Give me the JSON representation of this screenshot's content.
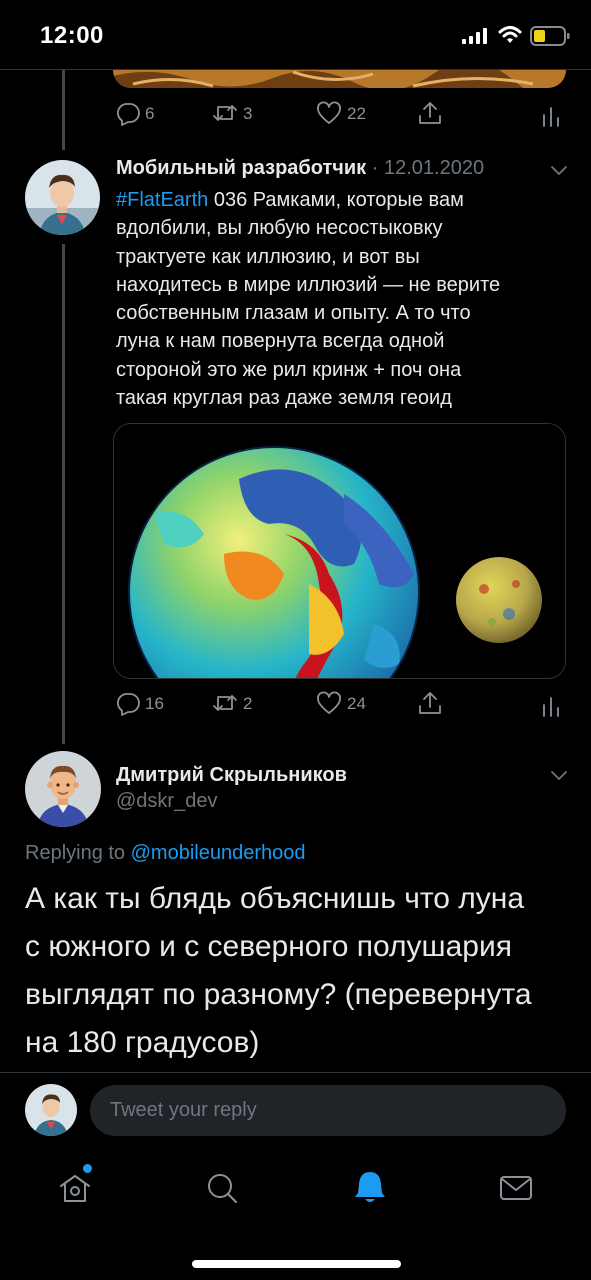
{
  "status_bar": {
    "time": "12:00"
  },
  "prev_tweet": {
    "actions": {
      "replies": "6",
      "retweets": "3",
      "likes": "22"
    }
  },
  "tweet": {
    "author": "Мобильный разработчик",
    "separator": " · ",
    "date": "12.01.2020",
    "hashtag": "#FlatEarth",
    "text_line1": " 036 Рамками, которые вам",
    "text_rest": "вдолбили, вы любую несостыковку\nтрактуете как иллюзию, и вот вы\nнаходитесь в мире иллюзий — не верите\nсобственным глазам и опыту. А то что\nлуна к нам повернута всегда одной\nстороной это же рил кринж + поч она\nтакая круглая раз даже земля геоид",
    "actions": {
      "replies": "16",
      "retweets": "2",
      "likes": "24"
    }
  },
  "reply": {
    "author": "Дмитрий Скрыльников",
    "handle": "@dskr_dev",
    "replying_label": "Replying to ",
    "replying_handle": "@mobileunderhood",
    "text": "А как ты блядь объяснишь что луна\nс южного и с северного полушария\nвыглядят по разному? (перевернута\nна 180 градусов)"
  },
  "composer": {
    "placeholder": "Tweet your reply"
  },
  "colors": {
    "accent": "#1d9bf0",
    "background": "#000000",
    "muted": "#6e767d"
  },
  "tabbar": {
    "icons": [
      "home-icon",
      "search-icon",
      "notifications-icon",
      "messages-icon"
    ],
    "active": "notifications-icon"
  }
}
